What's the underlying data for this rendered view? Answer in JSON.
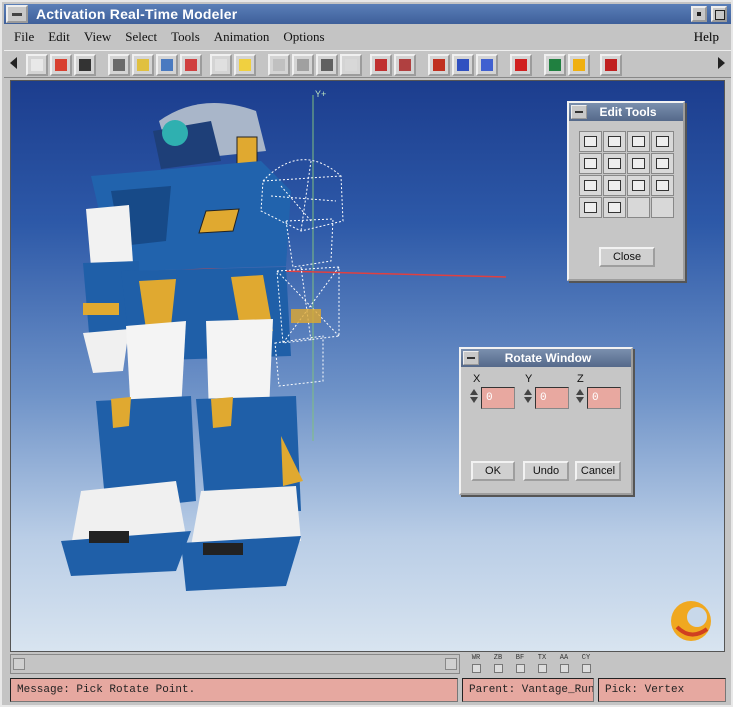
{
  "window": {
    "title": "Activation Real-Time Modeler"
  },
  "menu": {
    "items": [
      "File",
      "Edit",
      "View",
      "Select",
      "Tools",
      "Animation",
      "Options"
    ],
    "help": "Help"
  },
  "toolbar": {
    "icons": [
      "new-file-icon",
      "open-icon",
      "save-icon",
      "cut-icon",
      "paste-icon",
      "copy-icon",
      "delete-icon",
      "grid-icon",
      "sphere-icon",
      "move-icon",
      "rotate-icon",
      "scale-icon",
      "home-icon",
      "list-icon",
      "list-alt-icon",
      "cube-red-icon",
      "cube-blue-icon",
      "plane-icon",
      "pointer-icon",
      "green-mode-icon",
      "yellow-mode-icon",
      "red-mode-icon"
    ]
  },
  "viewport": {
    "axis_label": "Y+"
  },
  "edit_tools": {
    "title": "Edit Tools",
    "close_label": "Close"
  },
  "rotate_window": {
    "title": "Rotate Window",
    "x_label": "X",
    "y_label": "Y",
    "z_label": "Z",
    "x_value": "0",
    "y_value": "0",
    "z_value": "0",
    "ok_label": "OK",
    "undo_label": "Undo",
    "cancel_label": "Cancel"
  },
  "flags": {
    "labels": [
      "WR",
      "ZB",
      "BF",
      "TX",
      "AA",
      "CY"
    ]
  },
  "status": {
    "message": "Message: Pick Rotate Point.",
    "parent": "Parent: Vantage_Run.",
    "pick": "Pick: Vertex"
  },
  "colors": {
    "title_bar": "#3e5f9a",
    "status_fill": "#e6a8a0",
    "robot_blue": "#1f5fa8",
    "robot_gold": "#e0a930"
  }
}
